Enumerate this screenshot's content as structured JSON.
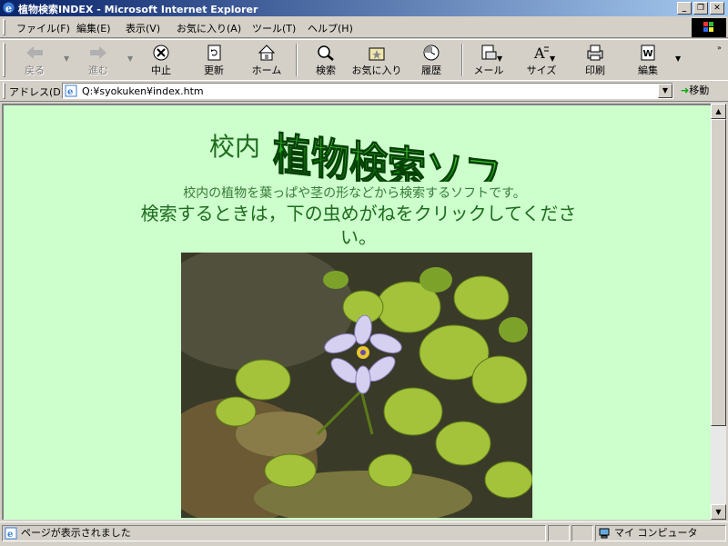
{
  "window": {
    "title": "植物検索INDEX - Microsoft Internet Explorer"
  },
  "menu": [
    "ファイル(F)",
    "編集(E)",
    "表示(V)",
    "お気に入り(A)",
    "ツール(T)",
    "ヘルプ(H)"
  ],
  "toolbar": {
    "back": "戻る",
    "forward": "進む",
    "stop": "中止",
    "refresh": "更新",
    "home": "ホーム",
    "search": "検索",
    "favorites": "お気に入り",
    "history": "履歴",
    "mail": "メール",
    "size": "サイズ",
    "print": "印刷",
    "edit": "編集"
  },
  "address": {
    "label": "アドレス(D)",
    "url": "Q:¥syokuken¥index.htm",
    "go": "移動"
  },
  "page": {
    "title_prefix": "校内",
    "title_logo": "植物検索ソフト",
    "description": "校内の植物を葉っぱや茎の形などから検索するソフトです。",
    "instruction": "検索するときは，下の虫めがねをクリックしてください。"
  },
  "status": {
    "text": "ページが表示されました",
    "zone": "マイ コンピュータ"
  },
  "colors": {
    "page_bg": "#ccffcc",
    "logo_green": "#119911",
    "text_green": "#1e6b1e"
  },
  "icons": [
    "ie-icon",
    "back-icon",
    "forward-icon",
    "stop-icon",
    "refresh-icon",
    "home-icon",
    "search-icon",
    "favorites-icon",
    "history-icon",
    "mail-icon",
    "size-icon",
    "print-icon",
    "edit-icon",
    "page-icon",
    "computer-icon"
  ]
}
